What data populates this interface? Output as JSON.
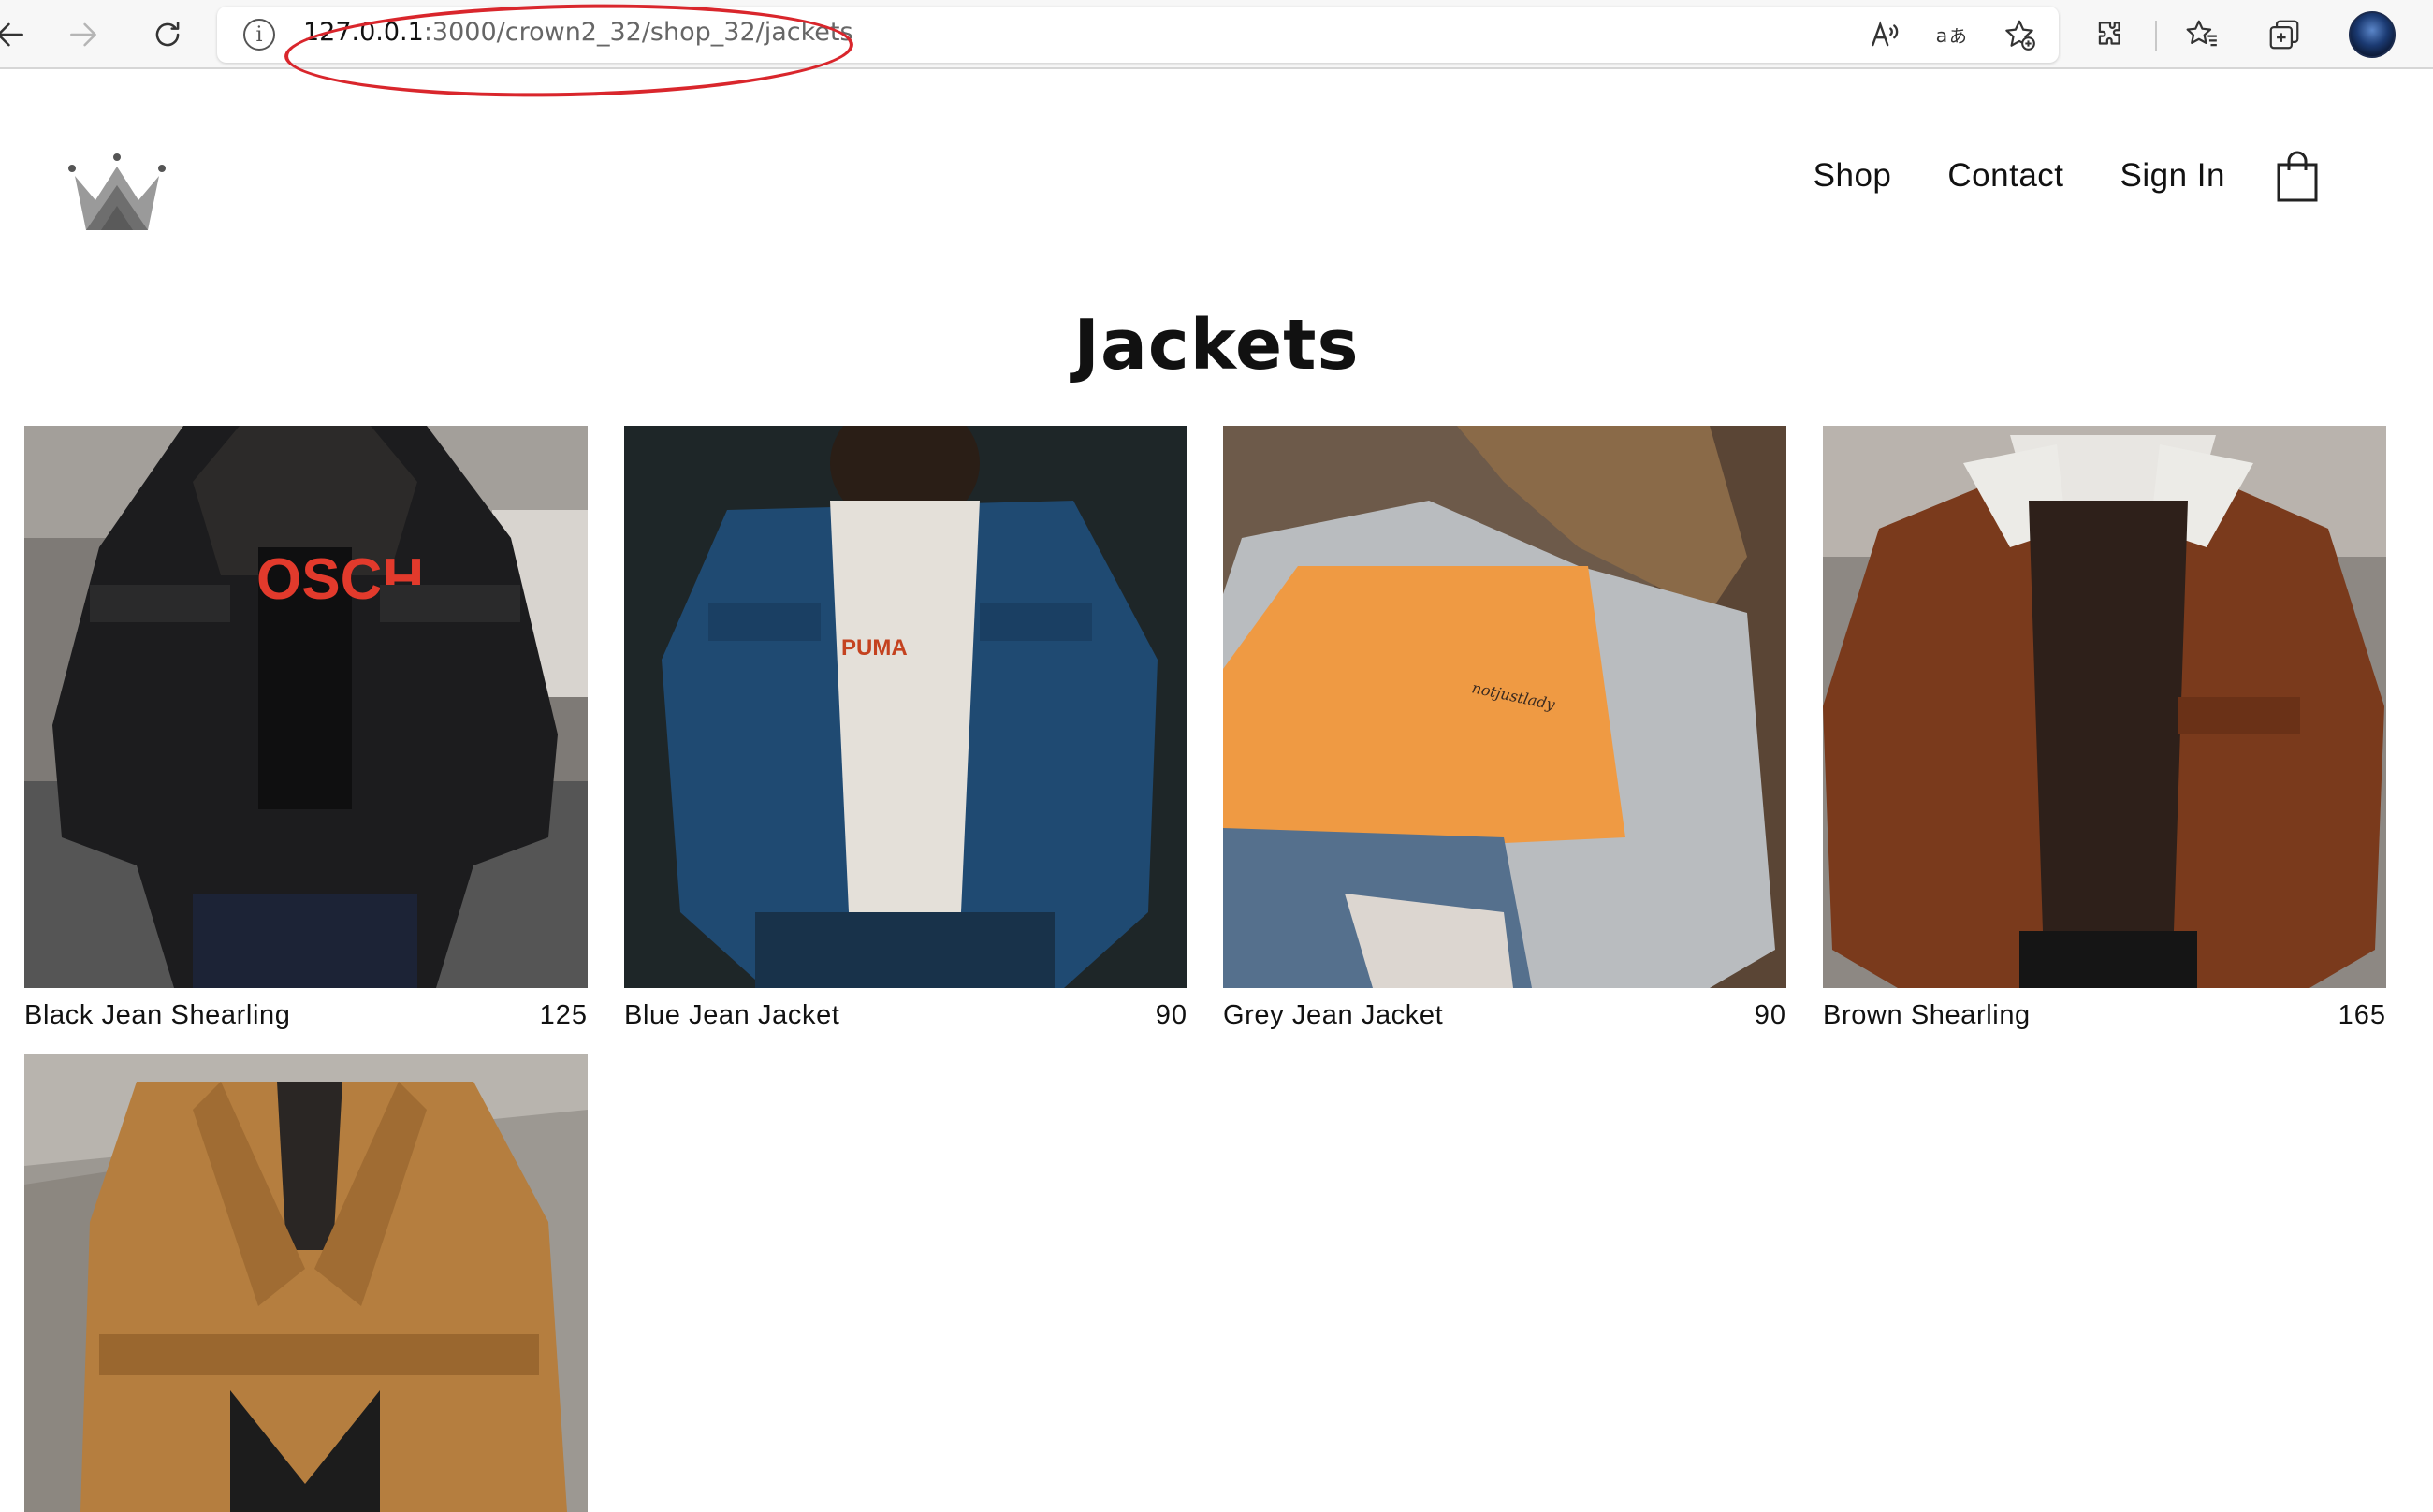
{
  "browser": {
    "url_host": "127.0.0.1",
    "url_path": ":3000/crown2_32/shop_32/jackets",
    "icons": [
      "back-icon",
      "forward-icon",
      "refresh-icon",
      "info-icon",
      "read-aloud-icon",
      "translate-icon",
      "add-favorite-icon",
      "extensions-icon",
      "favorites-icon",
      "collections-icon",
      "profile-avatar"
    ]
  },
  "header": {
    "logo": "crown-logo",
    "nav": {
      "shop": "Shop",
      "contact": "Contact",
      "sign_in": "Sign In"
    },
    "cart_icon": "shopping-bag-icon"
  },
  "page": {
    "title": "Jackets"
  },
  "products": [
    {
      "name": "Black Jean Shearling",
      "price": "125"
    },
    {
      "name": "Blue Jean Jacket",
      "price": "90"
    },
    {
      "name": "Grey Jean Jacket",
      "price": "90"
    },
    {
      "name": "Brown Shearling",
      "price": "165"
    },
    {
      "name": "",
      "price": ""
    }
  ],
  "annotation": {
    "highlight_color": "#d9262c"
  }
}
